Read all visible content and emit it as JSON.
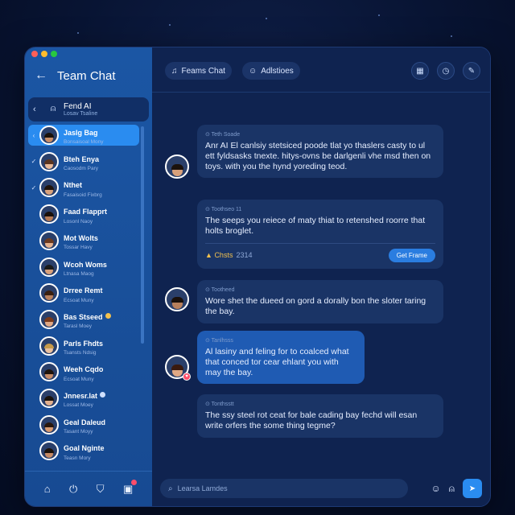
{
  "app": {
    "title": "Team Chat",
    "back_icon": "arrow-left-icon"
  },
  "pinned": {
    "name": "Fend AI",
    "subtitle": "Losav Tsaline"
  },
  "contacts": [
    {
      "name": "Jaslg Bag",
      "sub": "Bonsaisoal Mony",
      "active": true,
      "skin": "#c98e68",
      "hair": "#1b120c",
      "check": "‹"
    },
    {
      "name": "Bteh Enya",
      "sub": "Caosodm Pary",
      "active": false,
      "skin": "#e8b896",
      "hair": "#5a3520",
      "check": "✓"
    },
    {
      "name": "Nthet",
      "sub": "Fasaisoid Fixbrg",
      "active": false,
      "skin": "#d9a27c",
      "hair": "#20140c",
      "check": "✓"
    },
    {
      "name": "Faad Flapprt",
      "sub": "Losonl Naoy",
      "active": false,
      "skin": "#b57a55",
      "hair": "#1a100a",
      "check": ""
    },
    {
      "name": "Mot Wolts",
      "sub": "Tossar Havy",
      "active": false,
      "skin": "#e3b08c",
      "hair": "#6b3a1f",
      "check": ""
    },
    {
      "name": "Wcoh Woms",
      "sub": "Ltnasa Maog",
      "active": false,
      "skin": "#d8a07a",
      "hair": "#1a1a1a",
      "check": ""
    },
    {
      "name": "Drree Remt",
      "sub": "Ecsoat Muny",
      "active": false,
      "skin": "#b8805c",
      "hair": "#3a2010",
      "check": ""
    },
    {
      "name": "Bas Stseed",
      "sub": "Tarasl Moey",
      "active": false,
      "skin": "#e0a884",
      "hair": "#7a3a1a",
      "check": "",
      "dot": "#f2c14e"
    },
    {
      "name": "Parls Fhdts",
      "sub": "Tsansts Ndsig",
      "active": false,
      "skin": "#e9c09e",
      "hair": "#c79a4a",
      "check": ""
    },
    {
      "name": "Weeh Cqdo",
      "sub": "Ecsoat Muny",
      "active": false,
      "skin": "#c48a66",
      "hair": "#1f140c",
      "check": ""
    },
    {
      "name": "Jnnesr.lat",
      "sub": "Lossat Moey",
      "active": false,
      "skin": "#e2b08e",
      "hair": "#1a120c",
      "check": "",
      "dot": "#cfe0ff"
    },
    {
      "name": "Geal Daleud",
      "sub": "Tasant Moyy",
      "active": false,
      "skin": "#d89a70",
      "hair": "#2a180e",
      "check": ""
    },
    {
      "name": "Goal Nginte",
      "sub": "Teasn Mory",
      "active": false,
      "skin": "#c68a64",
      "hair": "#1c120a",
      "check": ""
    }
  ],
  "footer_icons": [
    "home-icon",
    "power-icon",
    "shield-icon",
    "notifications-icon"
  ],
  "tabs": [
    {
      "label": "Feams Chat",
      "icon": "music-note-icon",
      "glyph": "♫"
    },
    {
      "label": "Adlstioes",
      "icon": "user-icon",
      "glyph": "👤"
    }
  ],
  "top_icons": [
    {
      "name": "calendar-icon",
      "glyph": "▦"
    },
    {
      "name": "clock-icon",
      "glyph": "◷"
    },
    {
      "name": "edit-icon",
      "glyph": "✎"
    }
  ],
  "messages": [
    {
      "meta": "⊙ Teth Soade",
      "body": "Anr AI El canlsiy stetsiced poode tlat yo thaslers casty to ul ett fyldsasks tnexte. hitys-ovns be darlgenli vhe msd then on toys. with you the hynd yoreding teod.",
      "avatar": true,
      "skin": "#d8a07a",
      "hair": "#1b120c"
    },
    {
      "meta": "⊙ Toothseo 11",
      "body": "The seeps you reiece of maty thiat to retenshed roorre that holts broglet.",
      "avatar": false,
      "chart_label": "Chsts",
      "chart_value": "2314",
      "action": "Get Frame"
    },
    {
      "meta": "⊙ Tootheed",
      "body": "Wore shet the dueed on gord a dorally bon the sloter taring the bay.",
      "avatar": true,
      "skin": "#b8805c",
      "hair": "#1a100a"
    },
    {
      "meta": "⊙ Tanlhsss",
      "body": "Al lasiny and feling for to coalced what that conced tor cear ehlant you with may the bay.",
      "avatar": true,
      "skin": "#e0a884",
      "hair": "#3a1a0e",
      "sent": true
    },
    {
      "meta": "⊙ Tonthsstt",
      "body": "The ssy steel rot ceat for bale cading bay fechd will esan write orfers the some thing tegme?",
      "avatar": false
    }
  ],
  "composer": {
    "placeholder": "Learsa Lamdes",
    "search_icon": "search-icon"
  },
  "bottom_icons": [
    "emoji-icon",
    "profile-icon",
    "send-icon"
  ]
}
